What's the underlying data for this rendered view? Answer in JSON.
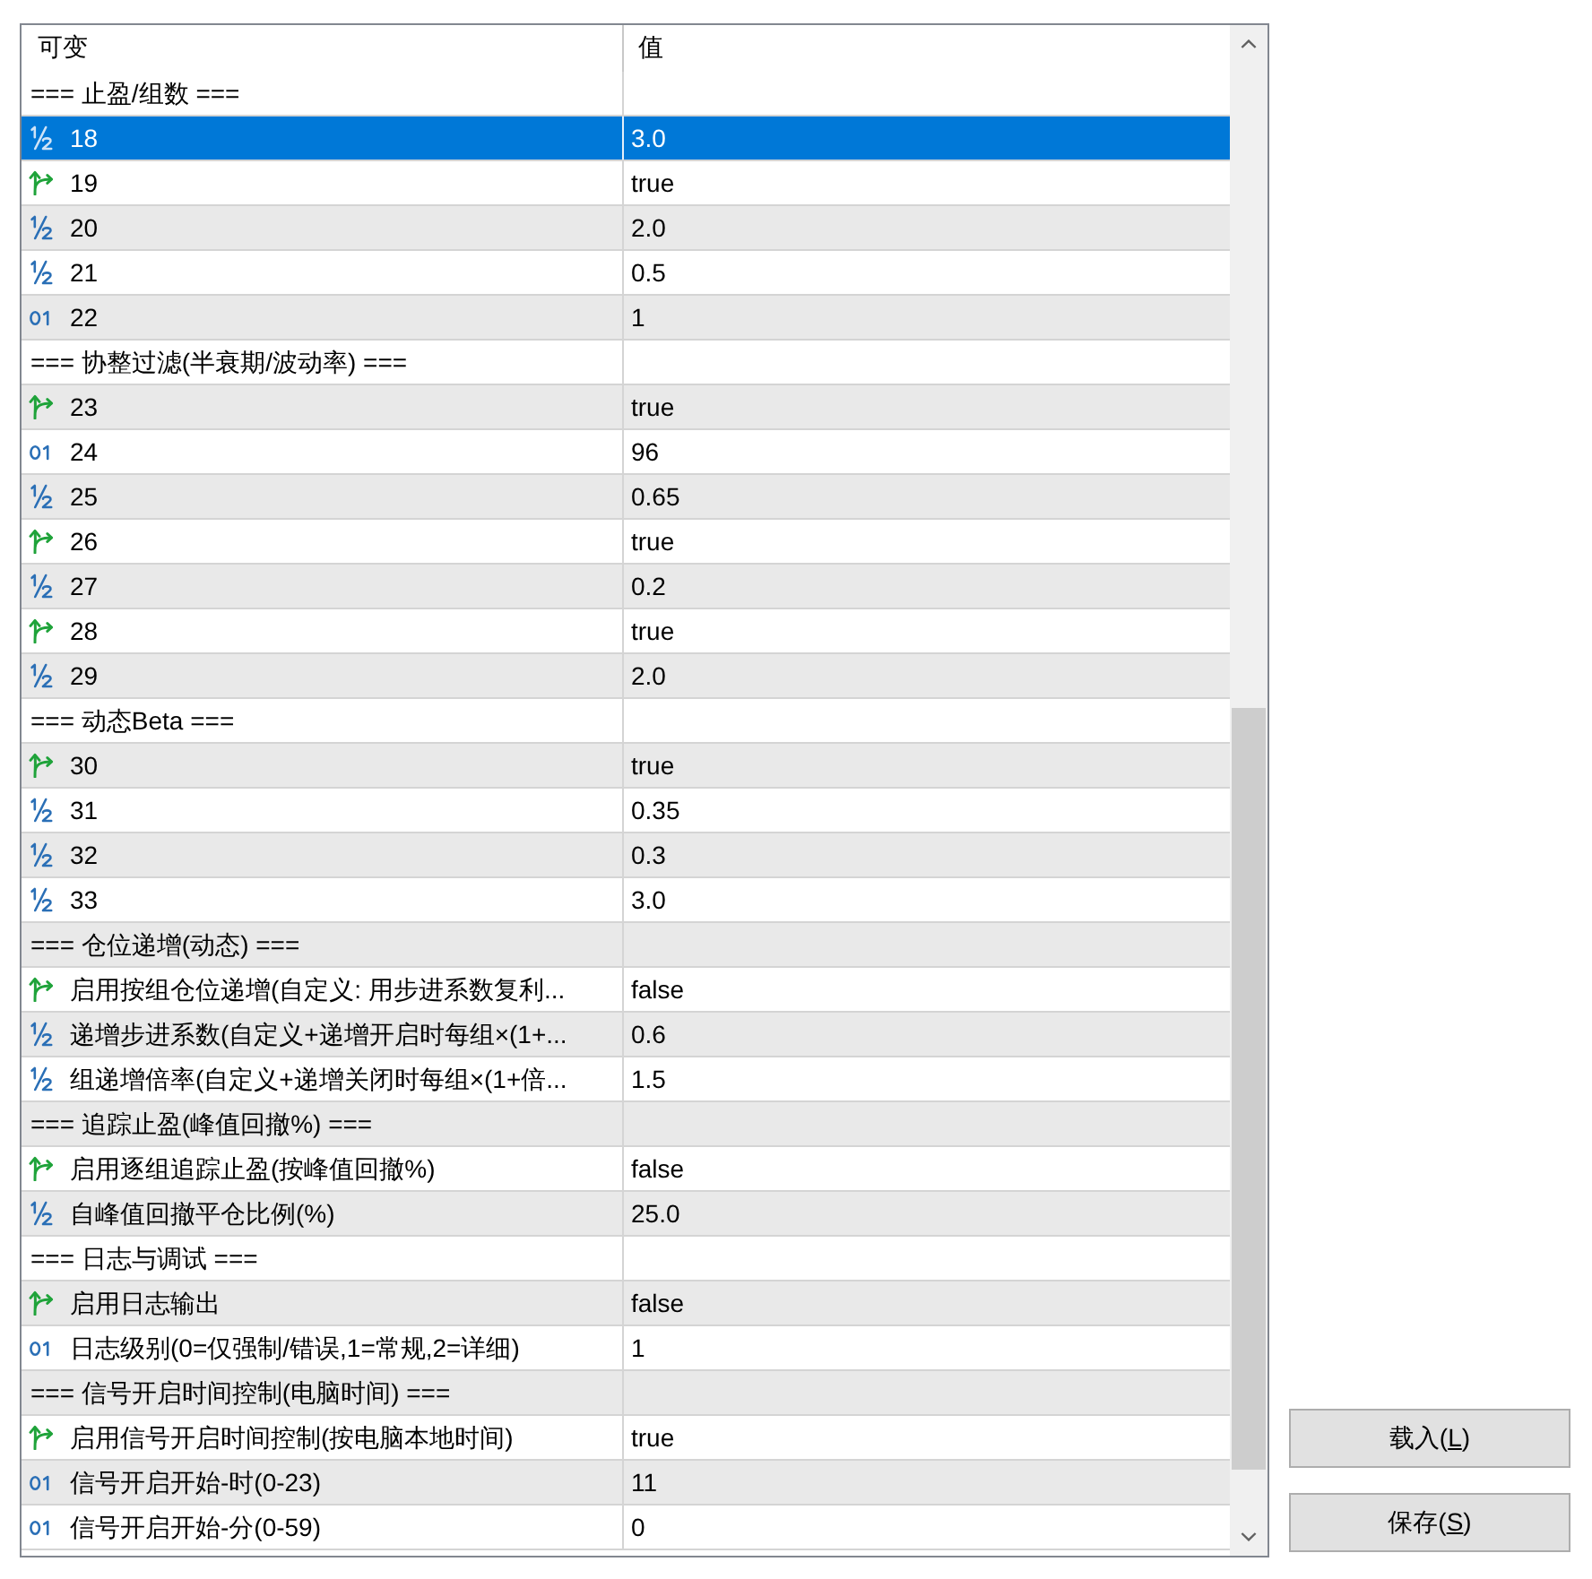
{
  "table": {
    "columns": [
      "可变",
      "值"
    ],
    "rows": [
      {
        "kind": "group",
        "name": "=== 止盈/组数 ===",
        "selected": false
      },
      {
        "kind": "double",
        "name": "18",
        "value": "3.0",
        "selected": true
      },
      {
        "kind": "bool",
        "name": "19",
        "value": "true",
        "selected": false
      },
      {
        "kind": "double",
        "name": "20",
        "value": "2.0",
        "selected": false
      },
      {
        "kind": "double",
        "name": "21",
        "value": "0.5",
        "selected": false
      },
      {
        "kind": "int",
        "name": "22",
        "value": "1",
        "selected": false
      },
      {
        "kind": "group",
        "name": "=== 协整过滤(半衰期/波动率) ===",
        "selected": false
      },
      {
        "kind": "bool",
        "name": "23",
        "value": "true",
        "selected": false
      },
      {
        "kind": "int",
        "name": "24",
        "value": "96",
        "selected": false
      },
      {
        "kind": "double",
        "name": "25",
        "value": "0.65",
        "selected": false
      },
      {
        "kind": "bool",
        "name": "26",
        "value": "true",
        "selected": false
      },
      {
        "kind": "double",
        "name": "27",
        "value": "0.2",
        "selected": false
      },
      {
        "kind": "bool",
        "name": "28",
        "value": "true",
        "selected": false
      },
      {
        "kind": "double",
        "name": "29",
        "value": "2.0",
        "selected": false
      },
      {
        "kind": "group",
        "name": "=== 动态Beta ===",
        "selected": false
      },
      {
        "kind": "bool",
        "name": "30",
        "value": "true",
        "selected": false
      },
      {
        "kind": "double",
        "name": "31",
        "value": "0.35",
        "selected": false
      },
      {
        "kind": "double",
        "name": "32",
        "value": "0.3",
        "selected": false
      },
      {
        "kind": "double",
        "name": "33",
        "value": "3.0",
        "selected": false
      },
      {
        "kind": "group",
        "name": "=== 仓位递增(动态) ===",
        "selected": false
      },
      {
        "kind": "bool",
        "name": "启用按组仓位递增(自定义: 用步进系数复利...",
        "value": "false",
        "selected": false
      },
      {
        "kind": "double",
        "name": "递增步进系数(自定义+递增开启时每组×(1+...",
        "value": "0.6",
        "selected": false
      },
      {
        "kind": "double",
        "name": "组递增倍率(自定义+递增关闭时每组×(1+倍...",
        "value": "1.5",
        "selected": false
      },
      {
        "kind": "group",
        "name": "=== 追踪止盈(峰值回撤%) ===",
        "selected": false
      },
      {
        "kind": "bool",
        "name": "启用逐组追踪止盈(按峰值回撤%)",
        "value": "false",
        "selected": false
      },
      {
        "kind": "double",
        "name": "自峰值回撤平仓比例(%)",
        "value": "25.0",
        "selected": false
      },
      {
        "kind": "group",
        "name": "=== 日志与调试 ===",
        "selected": false
      },
      {
        "kind": "bool",
        "name": "启用日志输出",
        "value": "false",
        "selected": false
      },
      {
        "kind": "int",
        "name": "日志级别(0=仅强制/错误,1=常规,2=详细)",
        "value": "1",
        "selected": false
      },
      {
        "kind": "group",
        "name": "=== 信号开启时间控制(电脑时间) ===",
        "selected": false
      },
      {
        "kind": "bool",
        "name": "启用信号开启时间控制(按电脑本地时间)",
        "value": "true",
        "selected": false
      },
      {
        "kind": "int",
        "name": "信号开启开始-时(0-23)",
        "value": "11",
        "selected": false
      },
      {
        "kind": "int",
        "name": "信号开启开始-分(0-59)",
        "value": "0",
        "selected": false
      }
    ]
  },
  "buttons": [
    {
      "text": "载入(",
      "access_key": "L",
      "text_after": ")"
    },
    {
      "text": "保存(",
      "access_key": "S",
      "text_after": ")"
    }
  ]
}
